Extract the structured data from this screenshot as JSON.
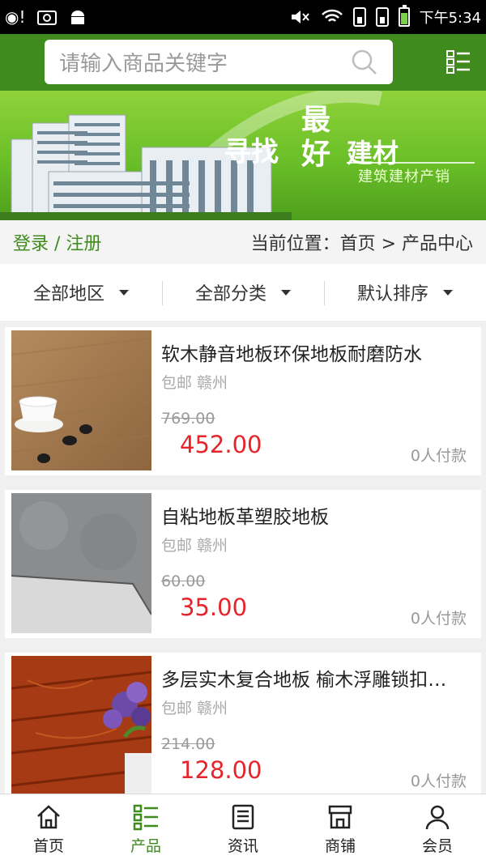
{
  "status_bar": {
    "time": "下午5:34",
    "icons": [
      "cd-icon",
      "screenshot-icon",
      "android-icon",
      "mute-icon",
      "wifi-icon",
      "sim1-icon",
      "sim2-icon",
      "battery-icon"
    ]
  },
  "header": {
    "search_placeholder": "请输入商品关键字",
    "search_icon": "search-icon",
    "menu_icon": "category-menu-icon"
  },
  "banner": {
    "line_find": "寻找",
    "line_best": "最好",
    "line_material": "建材",
    "subtitle": "建筑建材产销"
  },
  "breadcrumb": {
    "login": "登录 / 注册",
    "location": "当前位置：首页 > 产品中心"
  },
  "filters": [
    {
      "label": "全部地区"
    },
    {
      "label": "全部分类"
    },
    {
      "label": "默认排序"
    }
  ],
  "products": [
    {
      "name": "软木静音地板环保地板耐磨防水",
      "shipping": "包邮 赣州",
      "old_price": "769.00",
      "price": "452.00",
      "paid": "0人付款"
    },
    {
      "name": "自粘地板革塑胶地板",
      "shipping": "包邮 赣州",
      "old_price": "60.00",
      "price": "35.00",
      "paid": "0人付款"
    },
    {
      "name": "多层实木复合地板 榆木浮雕锁扣…",
      "shipping": "包邮 赣州",
      "old_price": "214.00",
      "price": "128.00",
      "paid": "0人付款"
    }
  ],
  "bottom_nav": [
    {
      "label": "首页",
      "icon": "home-icon",
      "active": false
    },
    {
      "label": "产品",
      "icon": "product-list-icon",
      "active": true
    },
    {
      "label": "资讯",
      "icon": "news-icon",
      "active": false
    },
    {
      "label": "商铺",
      "icon": "shop-icon",
      "active": false
    },
    {
      "label": "会员",
      "icon": "member-icon",
      "active": false
    }
  ],
  "colors": {
    "brand_green": "#3f8b1e",
    "price_red": "#e6242b",
    "banner_green": "#6abf28"
  }
}
